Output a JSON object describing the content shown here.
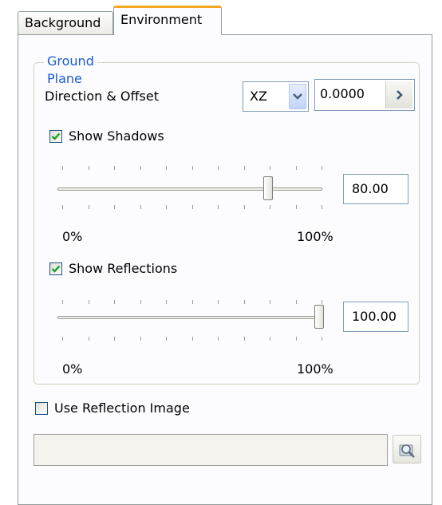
{
  "tabs": [
    {
      "label": "Background",
      "active": false
    },
    {
      "label": "Environment",
      "active": true
    }
  ],
  "ground_plane": {
    "title": "Ground Plane",
    "direction_label": "Direction & Offset",
    "direction_value": "XZ",
    "offset_value": "0.0000",
    "shadows": {
      "label": "Show Shadows",
      "checked": true,
      "slider_fraction": 0.8,
      "value": "80.00",
      "min_label": "0%",
      "max_label": "100%"
    },
    "reflections": {
      "label": "Show Reflections",
      "checked": true,
      "slider_fraction": 1.0,
      "value": "100.00",
      "min_label": "0%",
      "max_label": "100%"
    }
  },
  "reflection_image": {
    "label": "Use Reflection Image",
    "checked": false,
    "path_value": ""
  },
  "icons": {
    "combo": "chevron-down-icon",
    "offset_step": "chevron-right-icon",
    "browse": "magnifier-folder-icon"
  },
  "colors": {
    "active_tab_accent": "#f5a623",
    "group_title": "#1c5bd4"
  }
}
